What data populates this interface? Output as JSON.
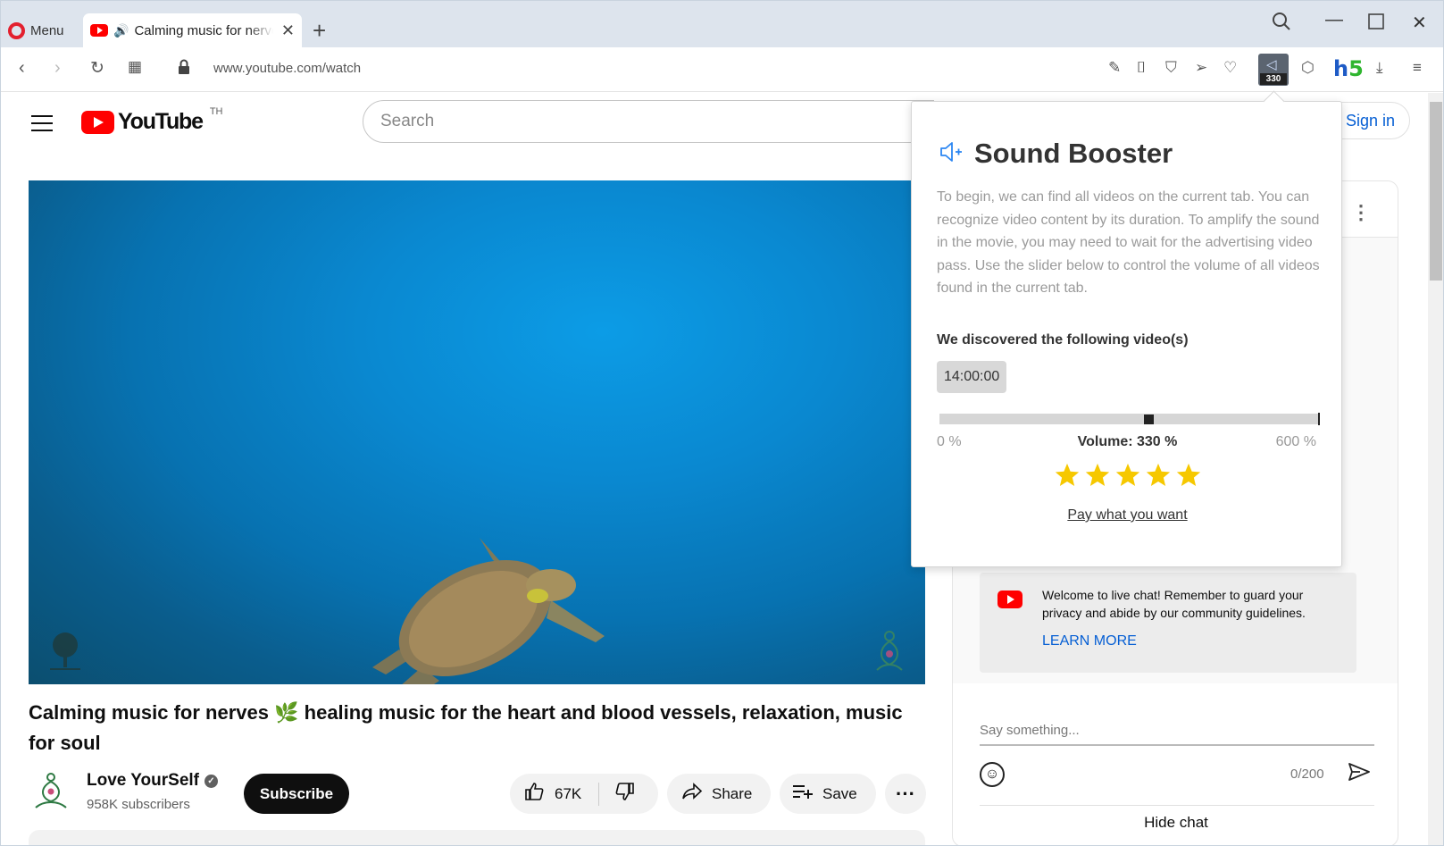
{
  "browser": {
    "menu_label": "Menu",
    "tab_title": "Calming music for nerves",
    "url": "www.youtube.com/watch",
    "extension_badge": "330",
    "h5_logo": {
      "h": "h",
      "five": "5"
    },
    "icons": [
      "opera-logo-icon",
      "speaker-icon",
      "close-icon",
      "plus-icon",
      "search-icon",
      "minimize-icon",
      "maximize-icon",
      "window-close-icon",
      "back-icon",
      "forward-icon",
      "reload-icon",
      "tabs-grid-icon",
      "lock-icon",
      "edit-icon",
      "camera-icon",
      "vpn-icon",
      "send-icon",
      "heart-icon",
      "sound-booster-icon",
      "cube-icon",
      "download-icon",
      "settings-icon"
    ]
  },
  "youtube": {
    "logo_text": "YouTube",
    "country_code": "TH",
    "search_placeholder": "Search",
    "sign_in": "Sign in",
    "video_title": "Calming music for nerves",
    "video_title_emoji": "🌿",
    "video_title_rest": "healing music for the heart and blood vessels, relaxation, music for soul",
    "channel_name": "Love YourSelf",
    "subscribers": "958K subscribers",
    "subscribe_label": "Subscribe",
    "likes": "67K",
    "share_label": "Share",
    "save_label": "Save"
  },
  "chat": {
    "welcome_text": "Welcome to live chat! Remember to guard your privacy and abide by our community guidelines.",
    "learn_more": "LEARN MORE",
    "input_placeholder": "Say something...",
    "char_counter": "0/200",
    "hide_chat": "Hide chat"
  },
  "sound_booster": {
    "title": "Sound Booster",
    "intro": "To begin, we can find all videos on the current tab. You can recognize video content by its duration. To amplify the sound in the movie, you may need to wait for the advertising video pass. Use the slider below to control the volume of all videos found in the current tab.",
    "found_heading": "We discovered the following video(s)",
    "video_duration": "14:00:00",
    "slider_min_label": "0 %",
    "slider_max_label": "600 %",
    "volume_label": "Volume: 330 %",
    "volume_value": 330,
    "volume_max": 600,
    "rating_stars": 5,
    "star_color": "#f6c800",
    "pay_link": "Pay what you want"
  },
  "colors": {
    "youtube_red": "#ff0000",
    "link_blue": "#065fd4",
    "opera_red": "#e3202e"
  }
}
